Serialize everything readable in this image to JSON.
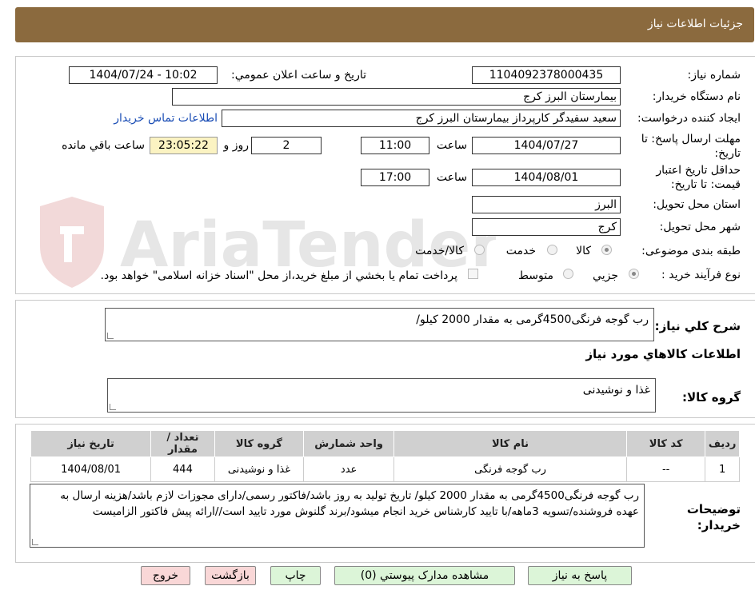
{
  "page_title": "جزئیات اطلاعات نیاز",
  "labels": {
    "need_number": "شماره نیاز:",
    "announce_datetime": "تاریخ و ساعت اعلان عمومي:",
    "buyer_org": "نام دستگاه خريدار:",
    "requester": "ايجاد كننده درخواست:",
    "buyer_contact": "اطلاعات تماس خریدار",
    "reply_deadline": "مهلت ارسال پاسخ: تا تاریخ:",
    "time": "ساعت",
    "day_and": "روز و",
    "remaining": "ساعت باقي مانده",
    "price_valid": "حداقل تاريخ اعتبار قيمت: تا تاريخ:",
    "province": "استان محل تحويل:",
    "city": "شهر محل تحويل:",
    "category": "طبقه بندی موضوعی:",
    "process": "نوع فرآيند خريد :",
    "general_desc": "شرح كلي نياز:",
    "items_info": "اطلاعات کالاهاي مورد نياز",
    "goods_group": "گروه کالا:",
    "buyer_notes": "توضيحات خريدار:"
  },
  "values": {
    "need_number": "1104092378000435",
    "announce_datetime": "1404/07/24 - 10:02",
    "buyer_org": "بیمارستان البرز کرج",
    "requester": "سعید سفیدگر کارپرداز بیمارستان البرز کرج",
    "reply_date": "1404/07/27",
    "reply_time": "11:00",
    "remaining_days": "2",
    "remaining_time": "23:05:22",
    "price_valid_date": "1404/08/01",
    "price_valid_time": "17:00",
    "province": "البرز",
    "city": "کرج",
    "general_desc": "رب گوجه فرنگی4500گرمی به مقدار 2000 کیلو/",
    "goods_group": "غذا و نوشیدنی",
    "buyer_notes": "رب گوجه فرنگی4500گرمی به مقدار 2000 کیلو/ تاریخ تولید به روز باشد/فاکتور رسمی/دارای مجوزات لازم باشد/هزینه ارسال به عهده فروشنده/تسویه 3ماهه/با تایید کارشناس خرید انجام میشود/برند گلنوش مورد تایید است//ارائه پیش فاکتور الزامیست"
  },
  "category_options": {
    "goods": "کالا",
    "service": "خدمت",
    "goods_service": "کالا/خدمت",
    "selected": "goods"
  },
  "process_options": {
    "minor": "جزيي",
    "medium": "متوسط",
    "treasury_note": "پرداخت تمام يا بخشي از مبلغ خريد،از محل \"اسناد خزانه اسلامی\" خواهد بود.",
    "selected": "minor"
  },
  "table": {
    "headers": [
      "رديف",
      "کد کالا",
      "نام کالا",
      "واحد شمارش",
      "گروه کالا",
      "تعداد / مقدار",
      "تاريخ نياز"
    ],
    "rows": [
      [
        "1",
        "--",
        "رب گوجه فرنگی",
        "عدد",
        "غذا و نوشیدنی",
        "444",
        "1404/08/01"
      ]
    ]
  },
  "buttons": {
    "reply": "پاسخ به نياز",
    "attachments": "مشاهده مدارک پيوستي (0)",
    "print": "چاپ",
    "back": "بازگشت",
    "exit": "خروج"
  },
  "watermark_text": "AriaTender.neT",
  "colors": {
    "title_bar": "#8b6a3e",
    "link": "#1a4db5",
    "button_green": "#dcf5d8",
    "button_pink": "#f9d7d7",
    "table_header": "#d0d0d0",
    "remaining_highlight": "#fbf3c2"
  }
}
